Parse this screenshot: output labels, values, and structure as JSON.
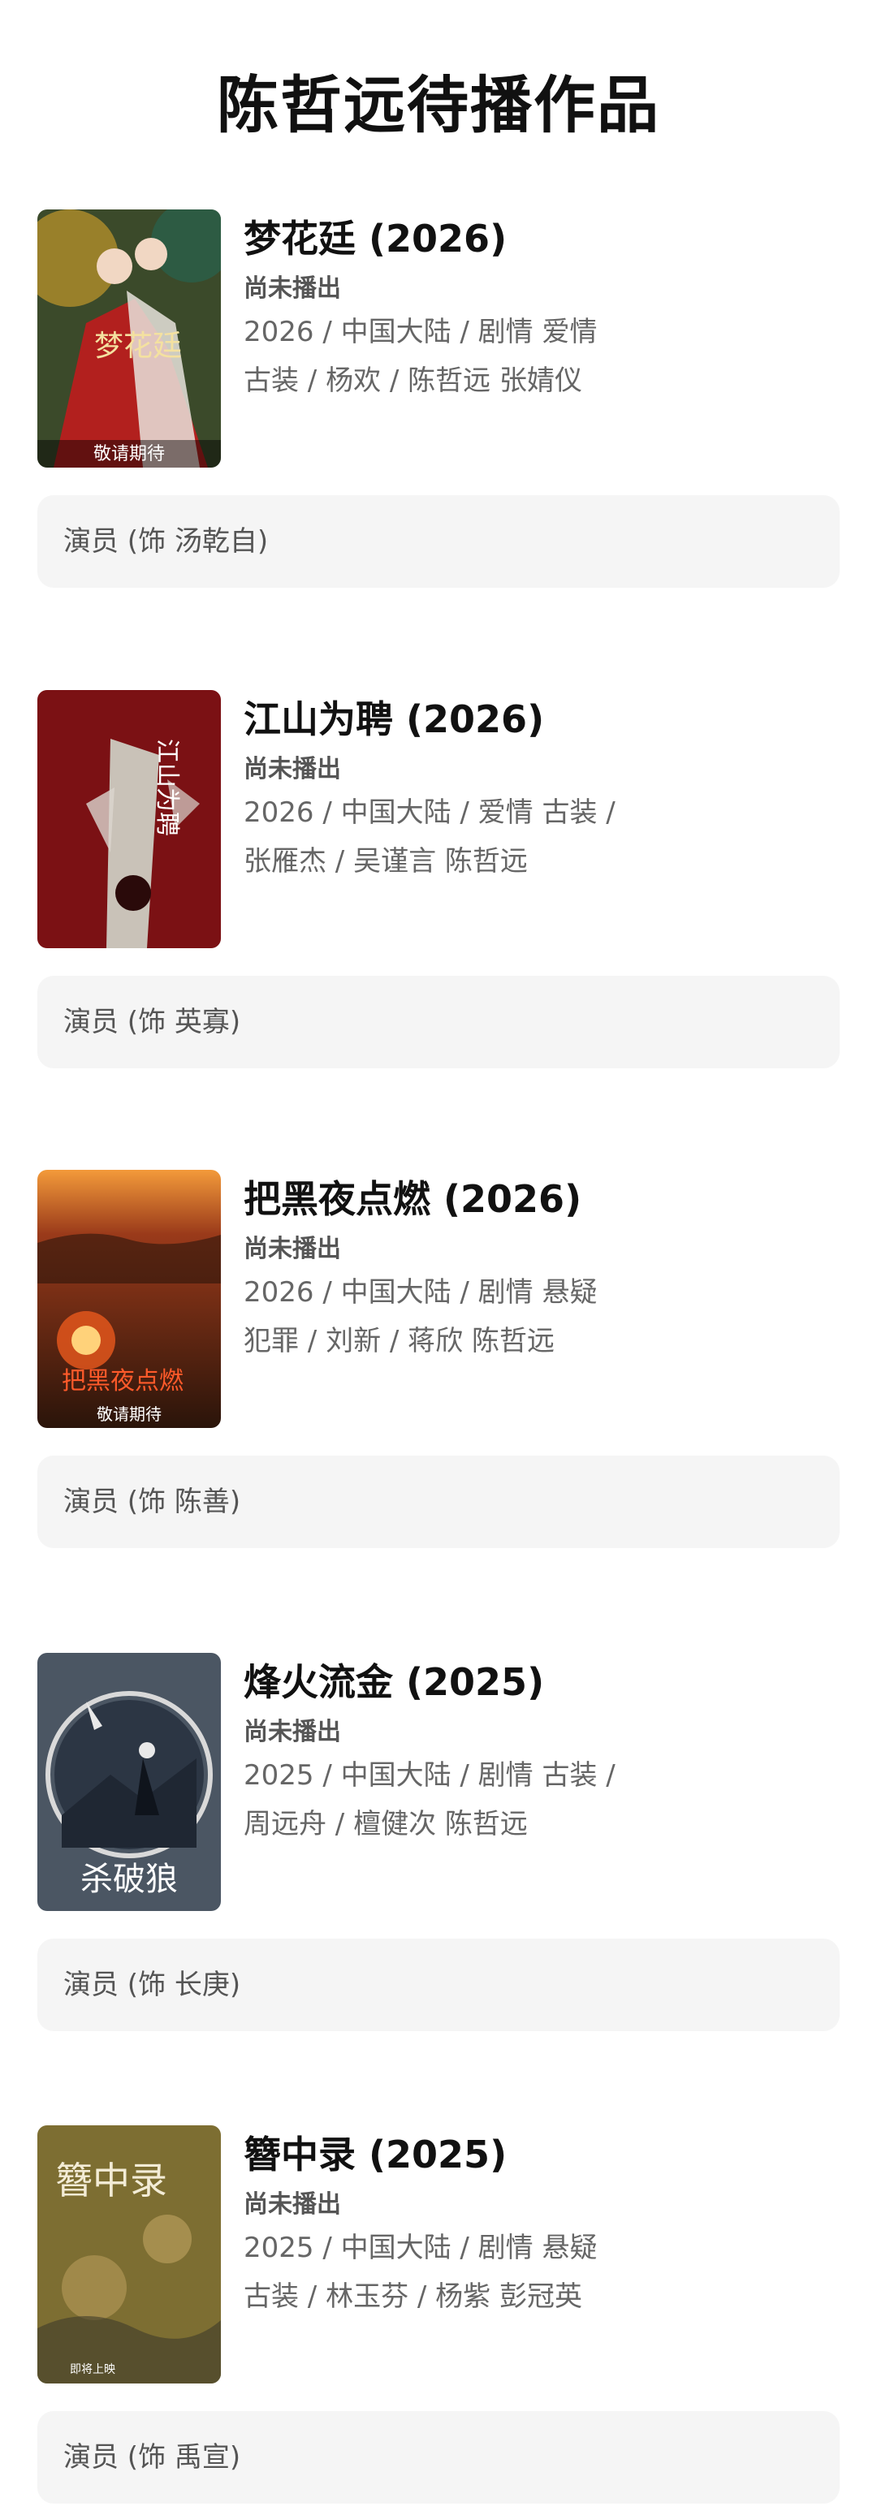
{
  "page": {
    "title": "陈哲远待播作品"
  },
  "works": [
    {
      "title": "梦花廷 (2026)",
      "status": "尚未播出",
      "meta_line1": "2026 / 中国大陆 / 剧情 爱情",
      "meta_line2": "古装 / 杨欢 / 陈哲远 张婧仪",
      "role": "演员 (饰 汤乾自)",
      "poster": {
        "title_text": "梦花廷",
        "bottom_text": "敬请期待",
        "bg": "#3b4a2a",
        "accent": "#b2201e"
      }
    },
    {
      "title": "江山为聘 (2026)",
      "status": "尚未播出",
      "meta_line1": "2026 / 中国大陆 / 爱情 古装 /",
      "meta_line2": "张雁杰 / 吴谨言 陈哲远",
      "role": "演员 (饰 英寡)",
      "poster": {
        "title_text": "江山为聘",
        "bg": "#8e1417",
        "accent": "#c9c2b8"
      }
    },
    {
      "title": "把黑夜点燃 (2026)",
      "status": "尚未播出",
      "meta_line1": "2026 / 中国大陆 / 剧情 悬疑",
      "meta_line2": "犯罪 / 刘新 / 蒋欣 陈哲远",
      "role": "演员 (饰 陈善)",
      "poster": {
        "title_text": "把黑夜点燃",
        "bottom_text": "敬请期待",
        "bg": "#3a1f12",
        "accent": "#e2561c"
      }
    },
    {
      "title": "烽火流金 (2025)",
      "status": "尚未播出",
      "meta_line1": "2025 / 中国大陆 / 剧情 古装 /",
      "meta_line2": "周远舟 / 檀健次 陈哲远",
      "role": "演员 (饰 长庚)",
      "poster": {
        "title_text": "杀破狼",
        "bg": "#4b5663",
        "accent": "#e9e9e9"
      }
    },
    {
      "title": "簪中录 (2025)",
      "status": "尚未播出",
      "meta_line1": "2025 / 中国大陆 / 剧情 悬疑",
      "meta_line2": "古装 / 林玉芬 / 杨紫 彭冠英",
      "role": "演员 (饰 禹宣)",
      "poster": {
        "title_text": "簪中录",
        "bottom_text": "即将上映",
        "bg": "#8e7d3a",
        "accent": "#f3ecd6"
      }
    }
  ]
}
